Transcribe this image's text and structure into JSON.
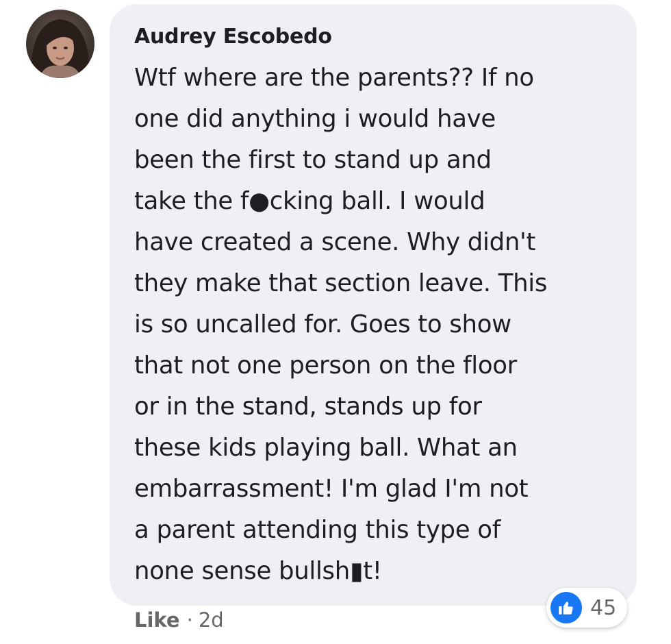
{
  "comment": {
    "author": "Audrey Escobedo",
    "avatar_icon": "profile-photo",
    "body_lines": [
      "Wtf where are the parents?? If no",
      "one did anything i would have",
      "been the first to stand up and",
      "take the f●cking ball. I would",
      "have created a scene. Why didn't",
      "they make that section leave. This",
      "is so uncalled for. Goes to show",
      "that not one person on the floor",
      "or in the stand, stands up for",
      "these kids playing ball. What an",
      "embarrassment! I'm glad I'm not",
      "a parent attending this type of",
      "none sense bullsh▮t!"
    ],
    "reactions": {
      "icon": "like-thumb-icon",
      "count": "45",
      "color": "#1877f2"
    },
    "actions": {
      "like_label": "Like",
      "separator": "·",
      "timestamp": "2d"
    }
  },
  "colors": {
    "bubble_background": "#eff0f3",
    "text": "#1c1e21",
    "secondary_text": "#65676b"
  }
}
